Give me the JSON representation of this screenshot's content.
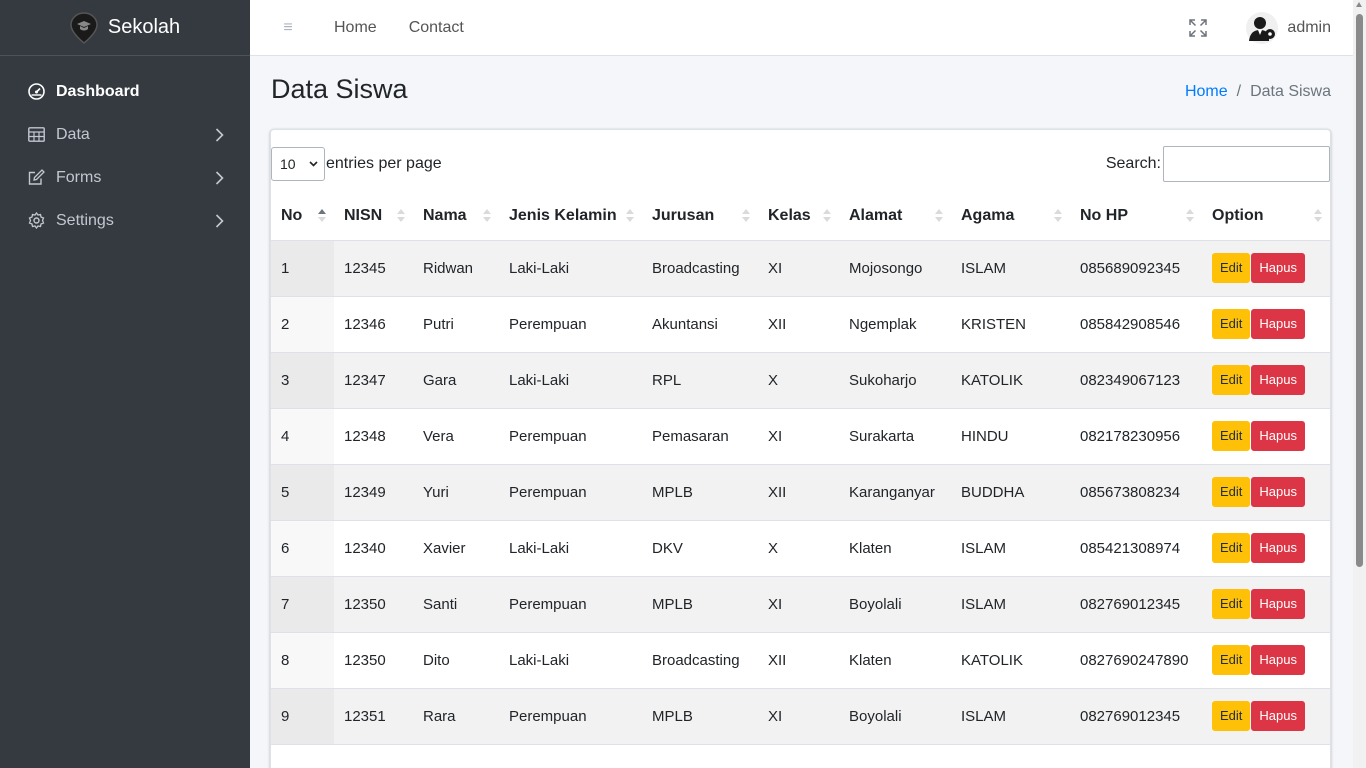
{
  "brand": {
    "name": "Sekolah"
  },
  "sidebar": {
    "items": [
      {
        "label": "Dashboard",
        "icon": "dashboard-gauge-icon",
        "active": true
      },
      {
        "label": "Data",
        "icon": "table-icon"
      },
      {
        "label": "Forms",
        "icon": "edit-icon"
      },
      {
        "label": "Settings",
        "icon": "gear-icon"
      }
    ]
  },
  "topbar": {
    "links": [
      "Home",
      "Contact"
    ],
    "user": "admin"
  },
  "header": {
    "title": "Data Siswa",
    "breadcrumb": {
      "home": "Home",
      "separator": "/",
      "current": "Data Siswa"
    }
  },
  "table": {
    "per_page_value": "10",
    "per_page_label": "entries per page",
    "search_label": "Search:",
    "search_value": "",
    "columns": [
      "No",
      "NISN",
      "Nama",
      "Jenis Kelamin",
      "Jurusan",
      "Kelas",
      "Alamat",
      "Agama",
      "No HP",
      "Option"
    ],
    "sorted_column": "No",
    "sort_direction": "asc",
    "edit_label": "Edit",
    "delete_label": "Hapus",
    "rows": [
      [
        "1",
        "12345",
        "Ridwan",
        "Laki-Laki",
        "Broadcasting",
        "XI",
        "Mojosongo",
        "ISLAM",
        "085689092345"
      ],
      [
        "2",
        "12346",
        "Putri",
        "Perempuan",
        "Akuntansi",
        "XII",
        "Ngemplak",
        "KRISTEN",
        "085842908546"
      ],
      [
        "3",
        "12347",
        "Gara",
        "Laki-Laki",
        "RPL",
        "X",
        "Sukoharjo",
        "KATOLIK",
        "082349067123"
      ],
      [
        "4",
        "12348",
        "Vera",
        "Perempuan",
        "Pemasaran",
        "XI",
        "Surakarta",
        "HINDU",
        "082178230956"
      ],
      [
        "5",
        "12349",
        "Yuri",
        "Perempuan",
        "MPLB",
        "XII",
        "Karanganyar",
        "BUDDHA",
        "085673808234"
      ],
      [
        "6",
        "12340",
        "Xavier",
        "Laki-Laki",
        "DKV",
        "X",
        "Klaten",
        "ISLAM",
        "085421308974"
      ],
      [
        "7",
        "12350",
        "Santi",
        "Perempuan",
        "MPLB",
        "XI",
        "Boyolali",
        "ISLAM",
        "082769012345"
      ],
      [
        "8",
        "12350",
        "Dito",
        "Laki-Laki",
        "Broadcasting",
        "XII",
        "Klaten",
        "KATOLIK",
        "0827690247890"
      ],
      [
        "9",
        "12351",
        "Rara",
        "Perempuan",
        "MPLB",
        "XI",
        "Boyolali",
        "ISLAM",
        "082769012345"
      ]
    ]
  },
  "colors": {
    "sidebar_bg": "#343a40",
    "link": "#007bff",
    "edit_button": "#ffc107",
    "delete_button": "#dc3545"
  }
}
